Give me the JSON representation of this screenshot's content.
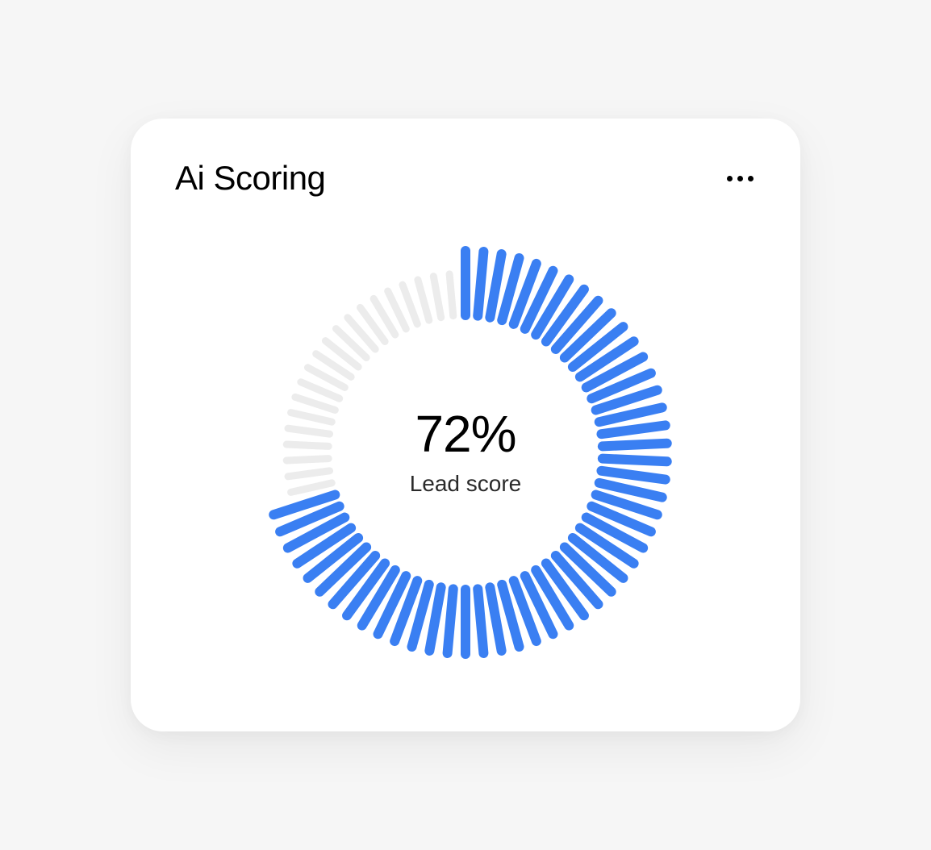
{
  "card": {
    "title": "Ai Scoring"
  },
  "gauge": {
    "value_text": "72%",
    "label": "Lead score"
  },
  "colors": {
    "accent": "#3a7ff2",
    "track": "#ececec"
  },
  "chart_data": {
    "type": "pie",
    "title": "Ai Scoring",
    "label": "Lead score",
    "value": 72,
    "max": 100,
    "total_ticks": 70,
    "filled_ticks": 50,
    "direction": "clockwise",
    "start_angle_deg": 0
  }
}
